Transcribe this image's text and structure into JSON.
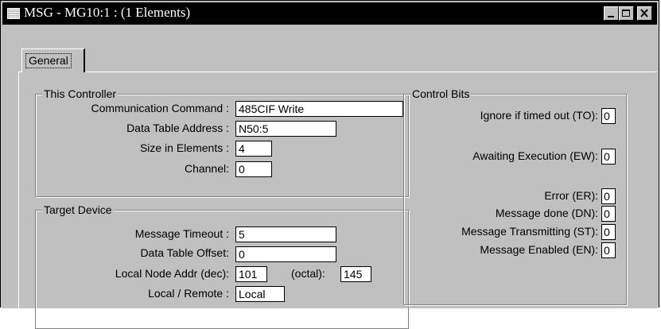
{
  "window": {
    "title": "MSG - MG10:1 : (1 Elements)",
    "icon": "message-window-icon",
    "controls": [
      "minimize-icon",
      "maximize-icon",
      "close-icon"
    ]
  },
  "tabs": [
    {
      "label": "General",
      "selected": true
    }
  ],
  "this_controller": {
    "title": "This Controller",
    "communication_command": {
      "label": "Communication Command :",
      "value": "485CIF Write"
    },
    "data_table_address": {
      "label": "Data Table Address :",
      "value": "N50:5"
    },
    "size_in_elements": {
      "label": "Size in Elements :",
      "value": "4"
    },
    "channel": {
      "label": "Channel:",
      "value": "0"
    }
  },
  "target_device": {
    "title": "Target Device",
    "message_timeout": {
      "label": "Message Timeout :",
      "value": "5"
    },
    "data_table_offset": {
      "label": "Data Table Offset:",
      "value": "0"
    },
    "local_node_addr": {
      "label": "Local Node Addr (dec):",
      "value": "101",
      "octal_label": "(octal):",
      "octal_value": "145"
    },
    "local_remote": {
      "label": "Local / Remote :",
      "value": "Local"
    }
  },
  "control_bits": {
    "title": "Control Bits",
    "ignore_if_timed_out": {
      "label": "Ignore if timed out (TO):",
      "value": "0"
    },
    "awaiting_execution": {
      "label": "Awaiting Execution (EW):",
      "value": "0"
    },
    "error": {
      "label": "Error (ER):",
      "value": "0"
    },
    "message_done": {
      "label": "Message done (DN):",
      "value": "0"
    },
    "message_transmitting": {
      "label": "Message Transmitting (ST):",
      "value": "0"
    },
    "message_enabled": {
      "label": "Message Enabled (EN):",
      "value": "0"
    }
  }
}
